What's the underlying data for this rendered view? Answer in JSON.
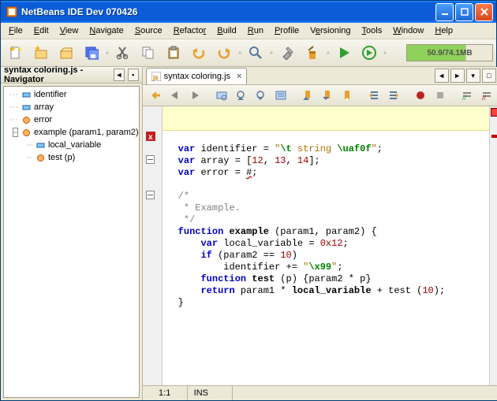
{
  "window": {
    "title": "NetBeans IDE Dev 070426"
  },
  "menus": {
    "file": "File",
    "edit": "Edit",
    "view": "View",
    "navigate": "Navigate",
    "source": "Source",
    "refactor": "Refactor",
    "build": "Build",
    "run": "Run",
    "profile": "Profile",
    "versioning": "Versioning",
    "tools": "Tools",
    "window": "Window",
    "help": "Help"
  },
  "memory": {
    "label": "50.9/74.1MB"
  },
  "navigator": {
    "title": "syntax coloring.js - Navigator",
    "items": [
      {
        "indent": 0,
        "expander": "",
        "icon": "field",
        "label": "identifier"
      },
      {
        "indent": 0,
        "expander": "",
        "icon": "field",
        "label": "array"
      },
      {
        "indent": 0,
        "expander": "",
        "icon": "method",
        "label": "error"
      },
      {
        "indent": 0,
        "expander": "minus",
        "icon": "method",
        "label": "example (param1, param2)"
      },
      {
        "indent": 1,
        "expander": "",
        "icon": "field",
        "label": "local_variable"
      },
      {
        "indent": 1,
        "expander": "",
        "icon": "method",
        "label": "test (p)"
      }
    ]
  },
  "tabs": {
    "active": "syntax coloring.js"
  },
  "code": {
    "lines": [
      {
        "t": "code",
        "frags": [
          [
            "kw",
            "var"
          ],
          [
            "txt",
            " identifier = "
          ],
          [
            "str",
            "\""
          ],
          [
            "esc",
            "\\t"
          ],
          [
            "str",
            " string "
          ],
          [
            "esc",
            "\\uaf0f"
          ],
          [
            "str",
            "\""
          ],
          [
            "txt",
            ";"
          ]
        ]
      },
      {
        "t": "code",
        "frags": [
          [
            "kw",
            "var"
          ],
          [
            "txt",
            " array = ["
          ],
          [
            "num",
            "12"
          ],
          [
            "txt",
            ", "
          ],
          [
            "num",
            "13"
          ],
          [
            "txt",
            ", "
          ],
          [
            "num",
            "14"
          ],
          [
            "txt",
            "];"
          ]
        ]
      },
      {
        "t": "code",
        "glyph": "err",
        "frags": [
          [
            "kw",
            "var"
          ],
          [
            "txt",
            " error = "
          ],
          [
            "wavy",
            "#"
          ],
          [
            "txt",
            ";"
          ]
        ]
      },
      {
        "t": "blank"
      },
      {
        "t": "code",
        "glyph": "fold",
        "frags": [
          [
            "cmt",
            "/*"
          ]
        ]
      },
      {
        "t": "code",
        "frags": [
          [
            "cmt",
            " * Example."
          ]
        ]
      },
      {
        "t": "code",
        "frags": [
          [
            "cmt",
            " */"
          ]
        ]
      },
      {
        "t": "code",
        "glyph": "fold",
        "frags": [
          [
            "kw",
            "function"
          ],
          [
            "txt",
            " "
          ],
          [
            "fn",
            "example"
          ],
          [
            "txt",
            " (param1, param2) {"
          ]
        ]
      },
      {
        "t": "code",
        "indent": 1,
        "frags": [
          [
            "kw",
            "var"
          ],
          [
            "txt",
            " local_variable = "
          ],
          [
            "num",
            "0x12"
          ],
          [
            "txt",
            ";"
          ]
        ]
      },
      {
        "t": "code",
        "indent": 1,
        "frags": [
          [
            "kw",
            "if"
          ],
          [
            "txt",
            " (param2 == "
          ],
          [
            "num",
            "10"
          ],
          [
            "txt",
            ")"
          ]
        ]
      },
      {
        "t": "code",
        "indent": 2,
        "frags": [
          [
            "txt",
            "identifier += "
          ],
          [
            "str",
            "\""
          ],
          [
            "esc",
            "\\x99"
          ],
          [
            "str",
            "\""
          ],
          [
            "txt",
            ";"
          ]
        ]
      },
      {
        "t": "code",
        "indent": 1,
        "frags": [
          [
            "kw",
            "function"
          ],
          [
            "txt",
            " "
          ],
          [
            "fn",
            "test"
          ],
          [
            "txt",
            " (p) {param2 * p}"
          ]
        ]
      },
      {
        "t": "code",
        "indent": 1,
        "frags": [
          [
            "kw",
            "return"
          ],
          [
            "txt",
            " param1 * "
          ],
          [
            "fn",
            "local_variable"
          ],
          [
            "txt",
            " + test ("
          ],
          [
            "num",
            "10"
          ],
          [
            "txt",
            ");"
          ]
        ]
      },
      {
        "t": "code",
        "frags": [
          [
            "txt",
            "}"
          ]
        ]
      }
    ]
  },
  "status": {
    "pos": "1:1",
    "mode": "INS"
  }
}
